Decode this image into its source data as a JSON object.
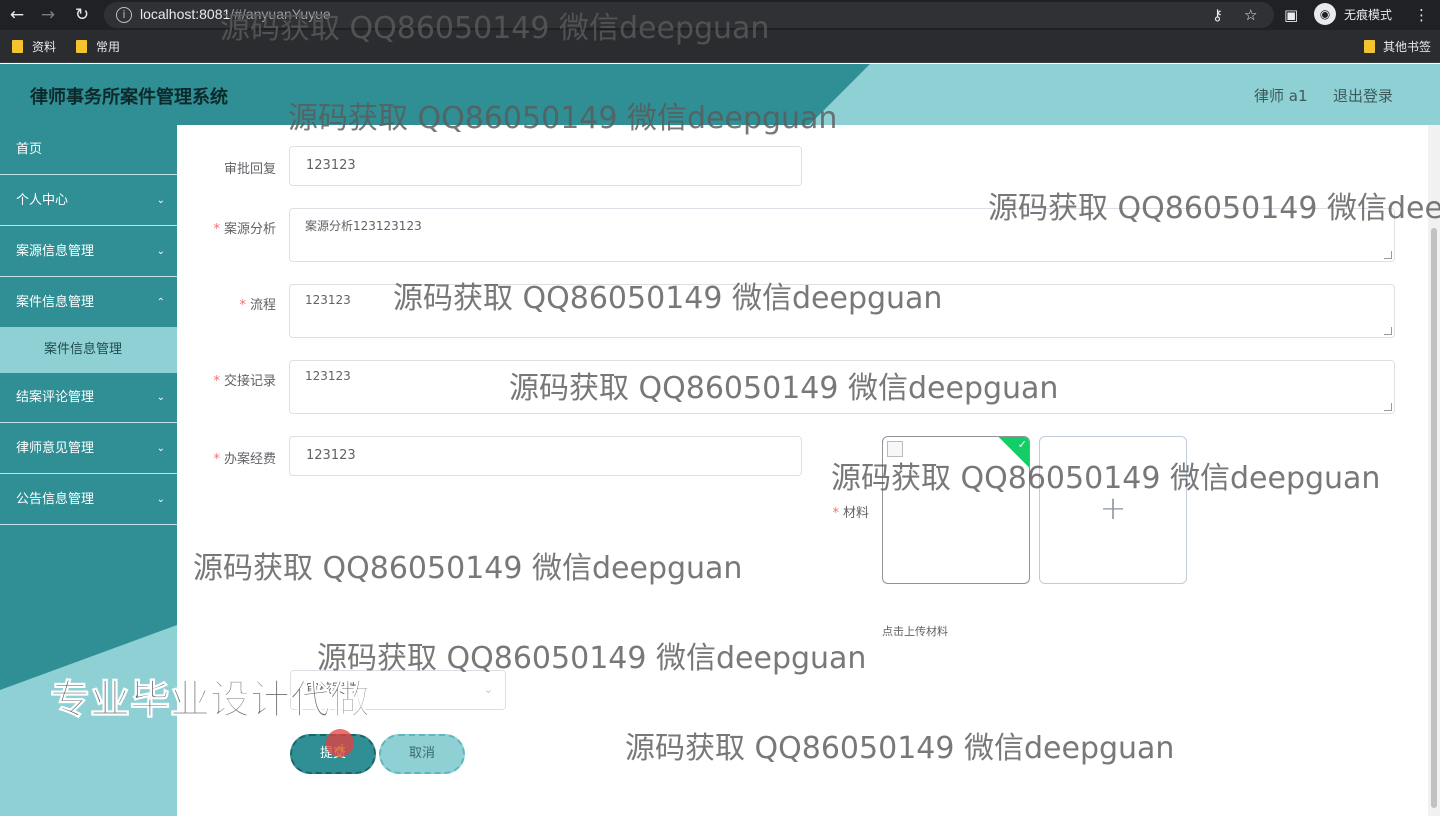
{
  "browser": {
    "url_host": "localhost:8081",
    "url_path": "/#/anyuanYuyue",
    "incognito_label": "无痕模式",
    "bookmarks": [
      "资料",
      "常用"
    ],
    "other_bookmarks": "其他书签"
  },
  "header": {
    "title": "律师事务所案件管理系统",
    "user": "律师 a1",
    "logout": "退出登录"
  },
  "sidebar": {
    "items": [
      {
        "label": "首页"
      },
      {
        "label": "个人中心"
      },
      {
        "label": "案源信息管理"
      },
      {
        "label": "案件信息管理"
      },
      {
        "label": "结案评论管理"
      },
      {
        "label": "律师意见管理"
      },
      {
        "label": "公告信息管理"
      }
    ],
    "sub_item": "案件信息管理"
  },
  "form": {
    "reply_label": "审批回复",
    "reply_value": "123123",
    "analysis_label": "案源分析",
    "analysis_value": "案源分析123123123",
    "process_label": "流程",
    "process_value": "123123",
    "handover_label": "交接记录",
    "handover_value": "123123",
    "expense_label": "办案经费",
    "expense_value": "123123",
    "material_label": "材料",
    "upload_tip": "点击上传材料",
    "select_value": "审核案件",
    "submit": "提交",
    "cancel": "取消"
  },
  "watermark": {
    "text": "源码获取 QQ86050149 微信deepguan",
    "big": "专业毕业设计代做"
  },
  "colors": {
    "primary": "#2f8f94",
    "secondary": "#8fd0d5",
    "required": "#f56c6c",
    "success": "#13ce66"
  }
}
